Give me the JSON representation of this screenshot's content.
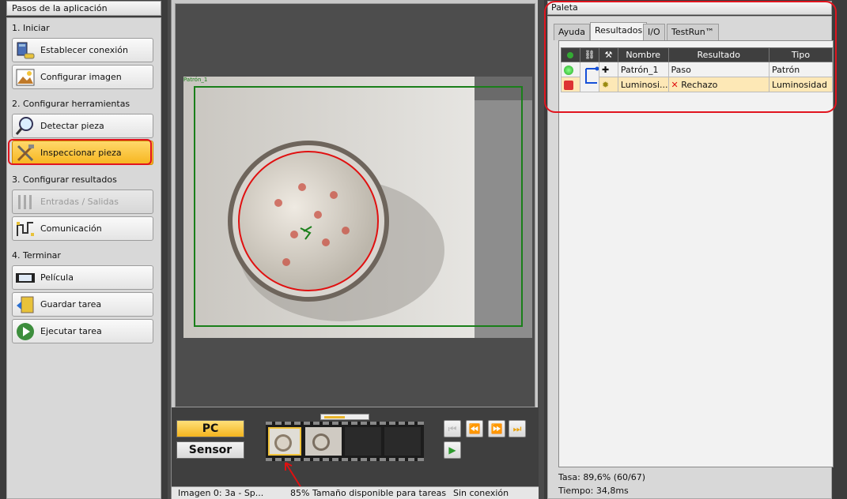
{
  "steps": {
    "title": "Pasos de la aplicación",
    "sections": [
      {
        "label": "1. Iniciar"
      },
      {
        "label": "2. Configurar herramientas"
      },
      {
        "label": "3. Configurar resultados"
      },
      {
        "label": "4. Terminar"
      }
    ],
    "buttons": [
      {
        "label": "Establecer conexión"
      },
      {
        "label": "Configurar imagen"
      },
      {
        "label": "Detectar pieza"
      },
      {
        "label": "Inspeccionar pieza"
      },
      {
        "label": "Entradas / Salidas"
      },
      {
        "label": "Comunicación"
      },
      {
        "label": "Película"
      },
      {
        "label": "Guardar tarea"
      },
      {
        "label": "Ejecutar tarea"
      }
    ]
  },
  "viewer": {
    "roi_label": "Patrón_1"
  },
  "source": {
    "pc": "PC",
    "sensor": "Sensor"
  },
  "status": {
    "image": "Imagen 0: 3a - Sp...",
    "space": "85% Tamaño disponible para tareas",
    "connection": "Sin conexión"
  },
  "palette": {
    "title": "Paleta",
    "tabs": [
      "Ayuda",
      "Resultados",
      "I/O",
      "TestRun™"
    ],
    "table": {
      "headers": [
        "Nombre",
        "Resultado",
        "Tipo"
      ],
      "rows": [
        {
          "name": "Patrón_1",
          "result": "Paso",
          "type": "Patrón",
          "status": "pass"
        },
        {
          "name": "Luminosi...",
          "result": "Rechazo",
          "type": "Luminosidad",
          "status": "fail"
        }
      ]
    },
    "tasa": "Tasa: 89,6% (60/67)",
    "tiempo": "Tiempo: 34,8ms"
  },
  "colors": {
    "accent": "#f7b51e",
    "highlight": "#e1141e",
    "roi": "#1a7f1a"
  }
}
